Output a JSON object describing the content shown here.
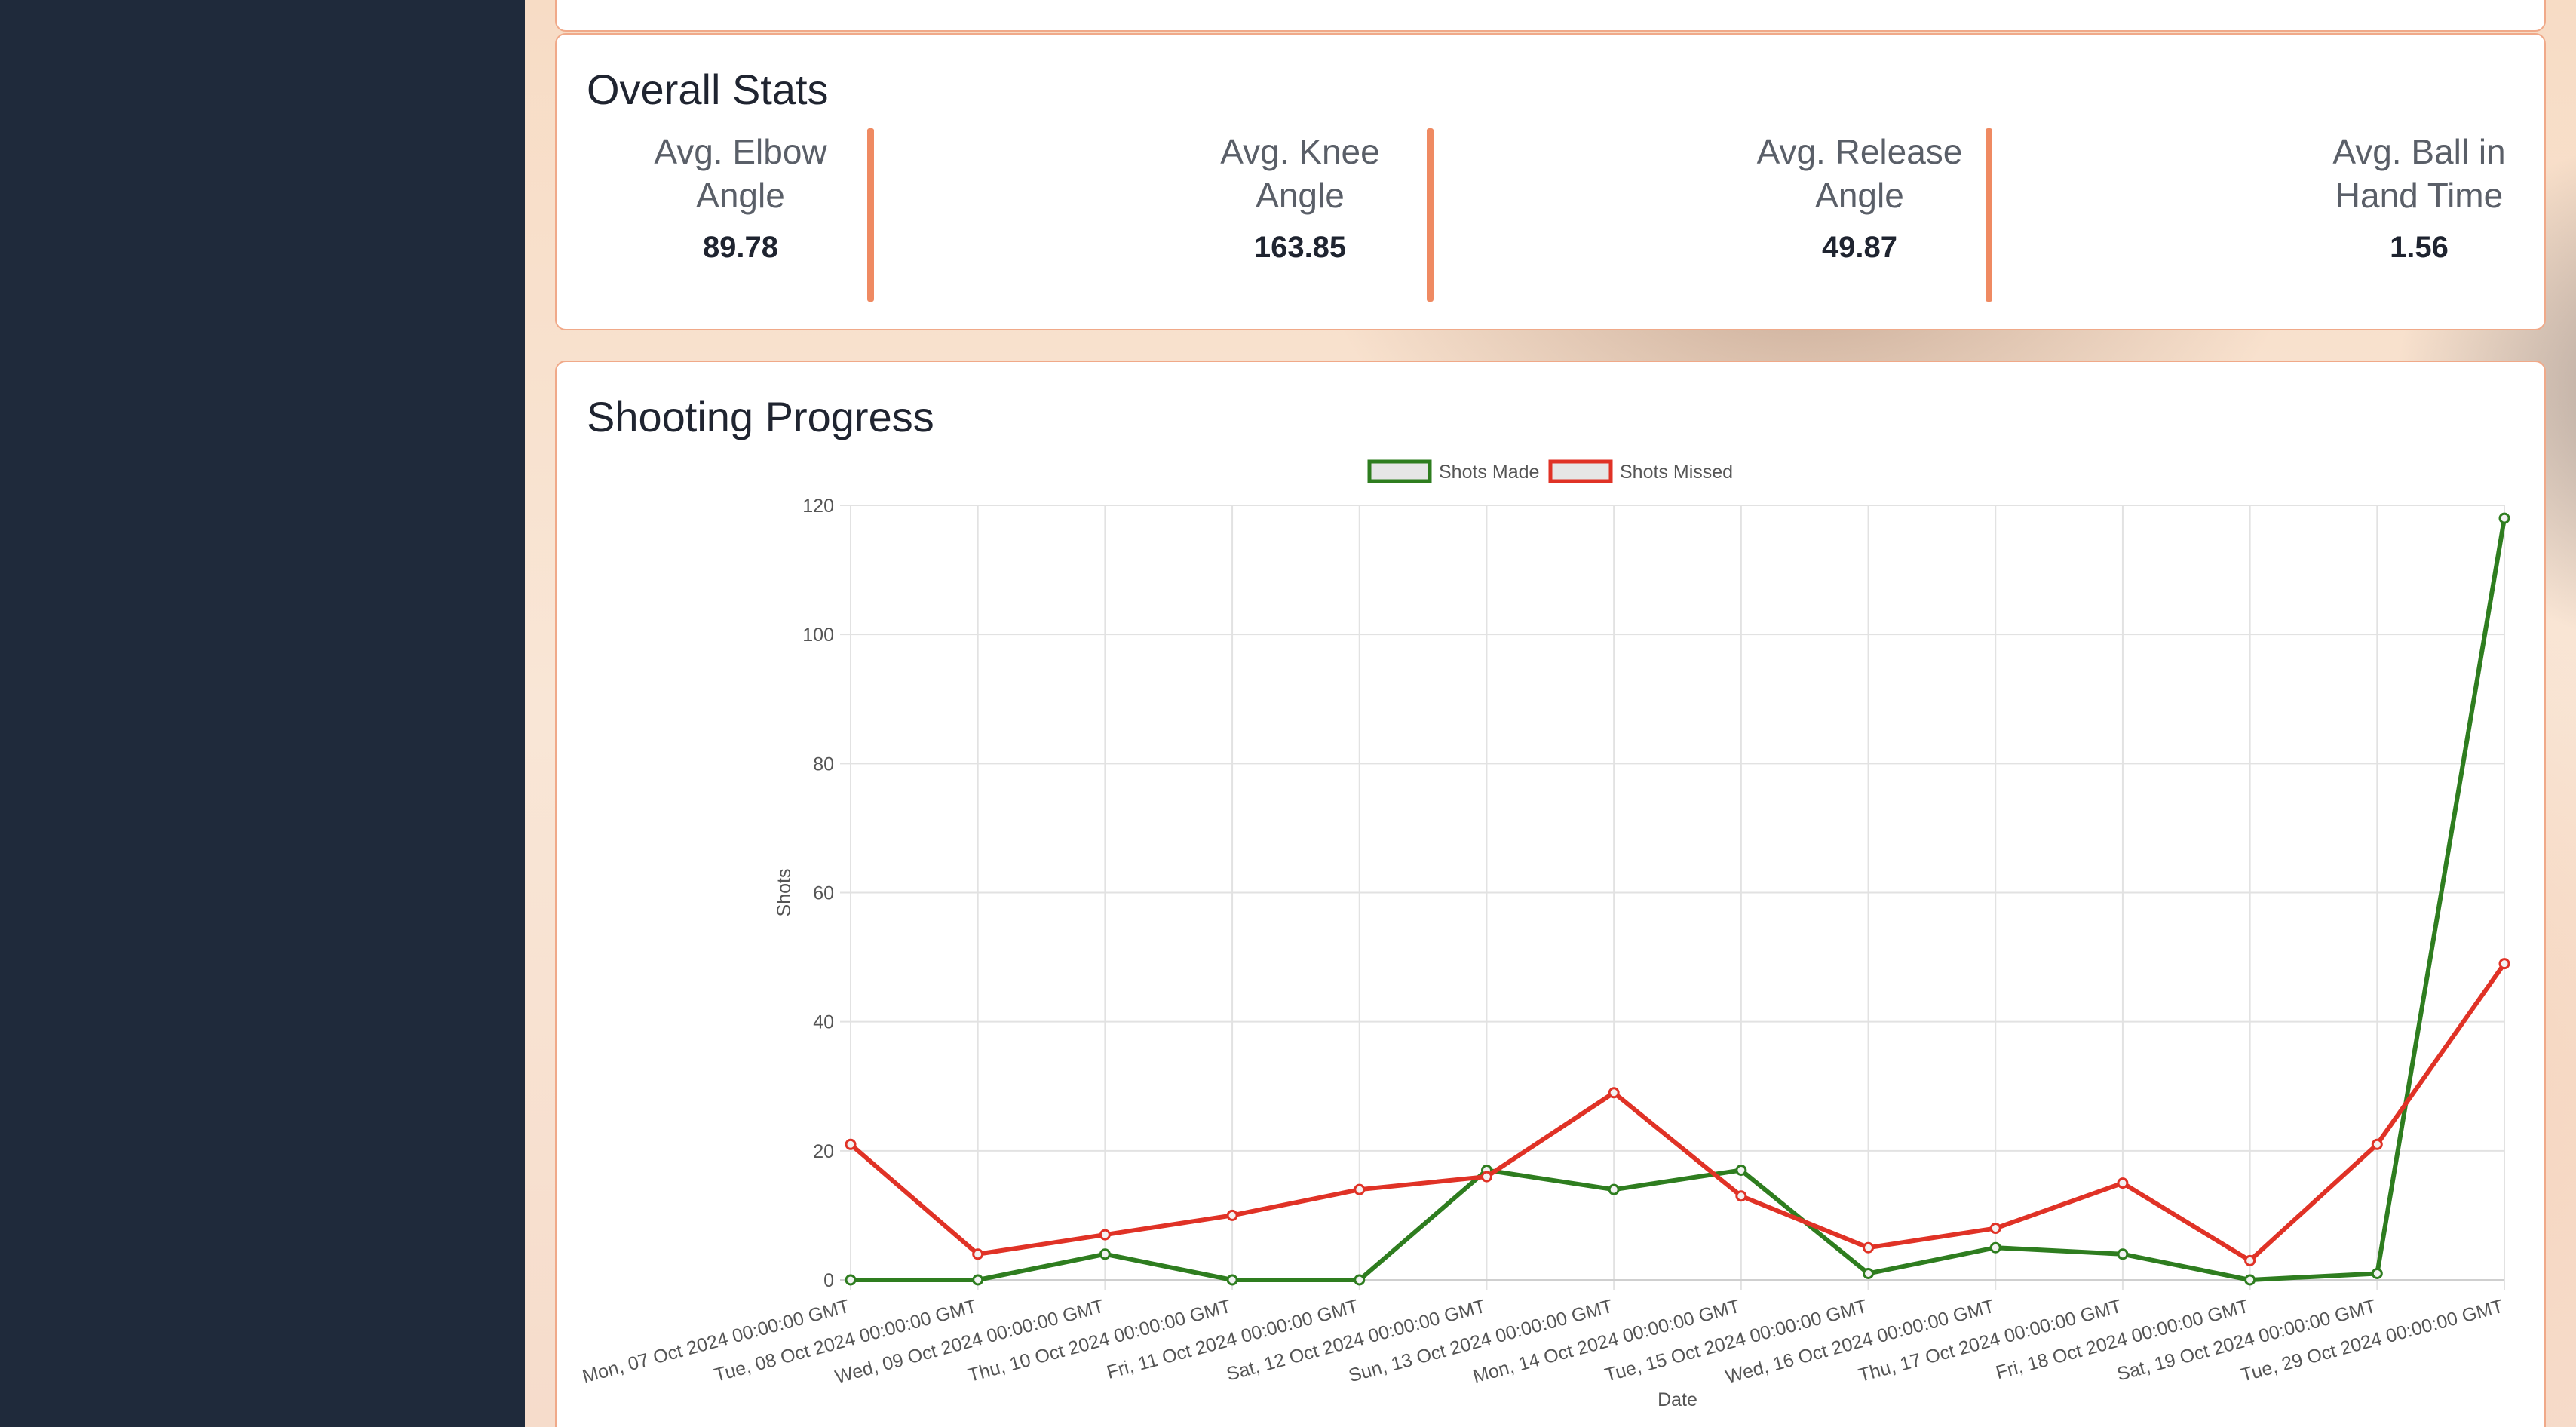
{
  "stats": {
    "title": "Overall Stats",
    "items": [
      {
        "label_line1": "Avg. Elbow",
        "label_line2": "Angle",
        "value": "89.78"
      },
      {
        "label_line1": "Avg. Knee",
        "label_line2": "Angle",
        "value": "163.85"
      },
      {
        "label_line1": "Avg. Release",
        "label_line2": "Angle",
        "value": "49.87"
      },
      {
        "label_line1": "Avg. Ball in",
        "label_line2": "Hand Time",
        "value": "1.56"
      }
    ]
  },
  "progress": {
    "title": "Shooting Progress"
  },
  "colors": {
    "sidebar": "#1f2a3b",
    "accent": "#ef8a62",
    "made": "#2e7d1f",
    "missed": "#e03226"
  },
  "chart_data": {
    "type": "line",
    "xlabel": "Date",
    "ylabel": "Shots",
    "ylim": [
      0,
      120
    ],
    "yticks": [
      0,
      20,
      40,
      60,
      80,
      100,
      120
    ],
    "grid": true,
    "legend_position": "top-center",
    "categories": [
      "Mon, 07 Oct 2024 00:00:00 GMT",
      "Tue, 08 Oct 2024 00:00:00 GMT",
      "Wed, 09 Oct 2024 00:00:00 GMT",
      "Thu, 10 Oct 2024 00:00:00 GMT",
      "Fri, 11 Oct 2024 00:00:00 GMT",
      "Sat, 12 Oct 2024 00:00:00 GMT",
      "Sun, 13 Oct 2024 00:00:00 GMT",
      "Mon, 14 Oct 2024 00:00:00 GMT",
      "Tue, 15 Oct 2024 00:00:00 GMT",
      "Wed, 16 Oct 2024 00:00:00 GMT",
      "Thu, 17 Oct 2024 00:00:00 GMT",
      "Fri, 18 Oct 2024 00:00:00 GMT",
      "Sat, 19 Oct 2024 00:00:00 GMT",
      "Tue, 29 Oct 2024 00:00:00 GMT"
    ],
    "series": [
      {
        "name": "Shots Made",
        "color": "#2e7d1f",
        "values": [
          0,
          0,
          4,
          0,
          0,
          17,
          14,
          17,
          1,
          5,
          4,
          0,
          1,
          118
        ]
      },
      {
        "name": "Shots Missed",
        "color": "#e03226",
        "values": [
          21,
          4,
          7,
          10,
          14,
          16,
          29,
          13,
          5,
          8,
          15,
          3,
          21,
          49
        ]
      }
    ]
  }
}
